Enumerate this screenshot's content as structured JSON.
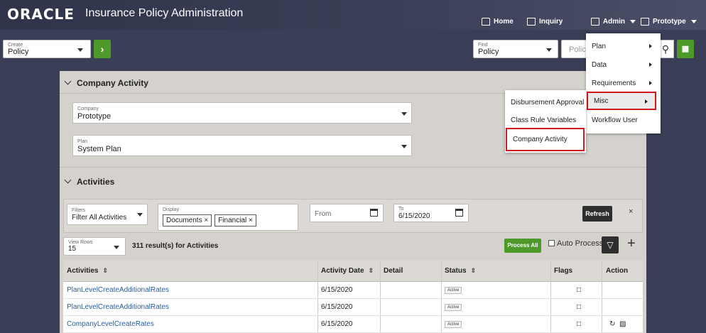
{
  "header": {
    "logo": "ORACLE",
    "title": "Insurance Policy Administration",
    "nav": {
      "home": "Home",
      "inquiry": "Inquiry",
      "admin": "Admin",
      "prototype": "Prototype"
    }
  },
  "subbar": {
    "create_label": "Create",
    "create_value": "Policy",
    "find_label": "Find",
    "find_value": "Policy",
    "search_placeholder": "Policy"
  },
  "company_activity": {
    "title": "Company Activity",
    "company_label": "Company",
    "company_value": "Prototype",
    "plan_label": "Plan",
    "plan_value": "System Plan"
  },
  "activities": {
    "title": "Activities",
    "filters_label": "Filters",
    "filters_value": "Filter All Activities",
    "display_label": "Display",
    "display_tags": [
      "Documents ×",
      "Financial ×"
    ],
    "from_label": "From",
    "to_label": "To",
    "to_value": "6/15/2020",
    "refresh": "Refresh",
    "close": "×",
    "view_rows_label": "View Rows",
    "view_rows_value": "15",
    "result_count": "311 result(s) for Activities",
    "process_all": "Process All",
    "auto_process": "Auto Process",
    "columns": {
      "activities": "Activities",
      "activity_date": "Activity Date",
      "detail": "Detail",
      "status": "Status",
      "flags": "Flags",
      "action": "Action"
    },
    "rows": [
      {
        "name": "PlanLevelCreateAdditionalRates",
        "date": "6/15/2020",
        "status": "Active"
      },
      {
        "name": "PlanLevelCreateAdditionalRates",
        "date": "6/15/2020",
        "status": "Active"
      },
      {
        "name": "CompanyLevelCreateRates",
        "date": "6/15/2020",
        "status": "Active"
      }
    ]
  },
  "admin_menu": {
    "items": [
      "Plan",
      "Data",
      "Requirements",
      "Misc",
      "Workflow User"
    ]
  },
  "misc_menu": {
    "items": [
      "Disbursement Approval",
      "Class Rule Variables",
      "Company Activity"
    ]
  },
  "colors": {
    "header_bg": "#3a3e56",
    "accent_green": "#4d9a2a",
    "highlight_red": "#d01820",
    "link_blue": "#2a5d9f"
  }
}
